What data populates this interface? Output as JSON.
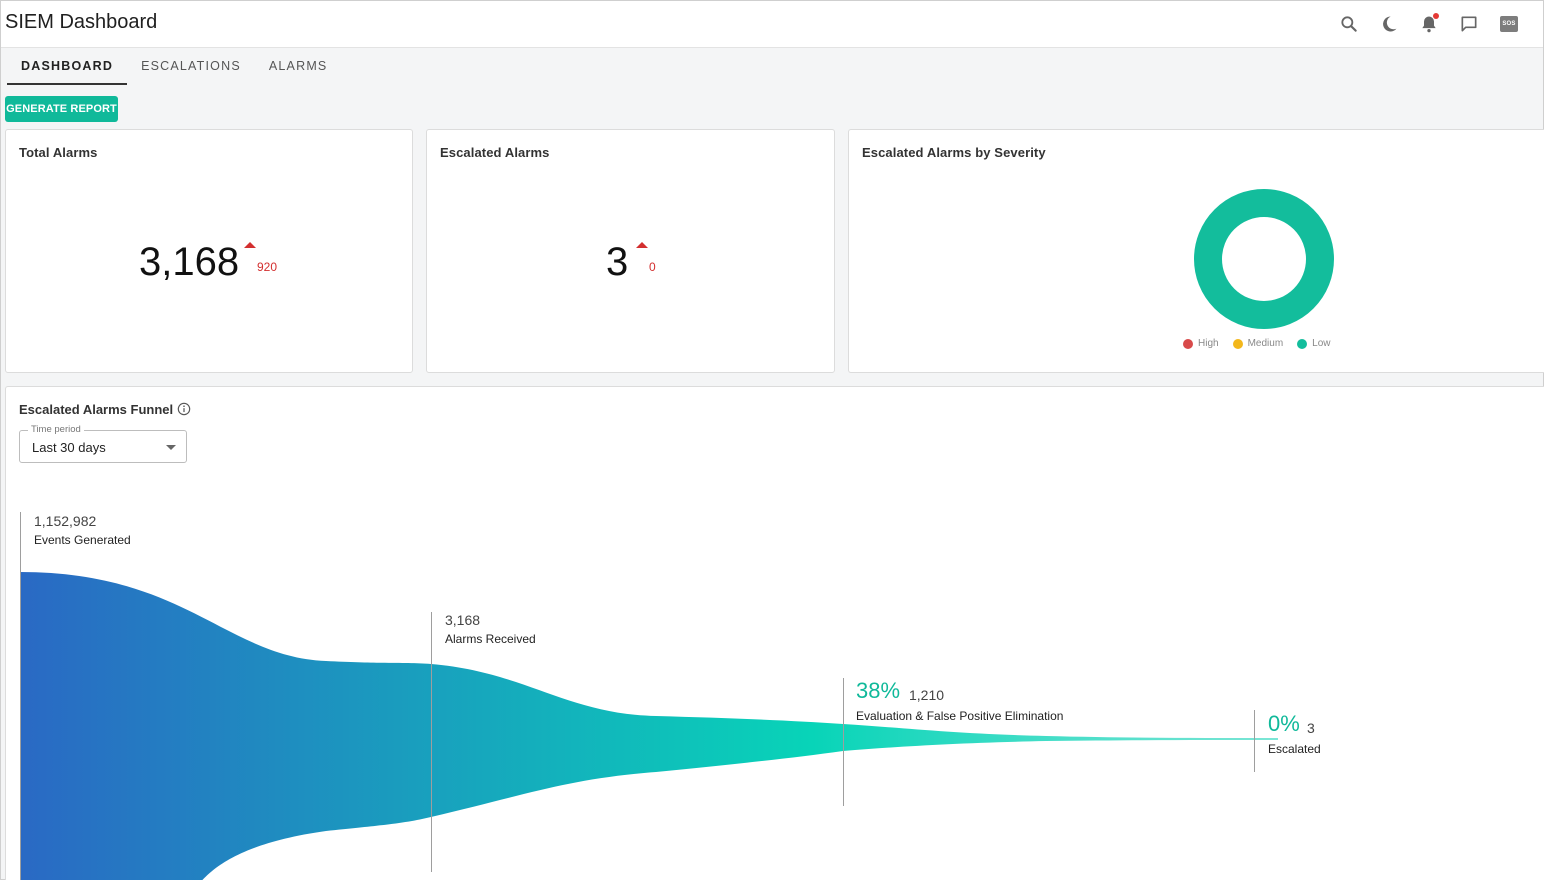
{
  "app": {
    "title": "SIEM Dashboard"
  },
  "top_icons": [
    "search-icon",
    "moon-icon",
    "bell-icon",
    "chat-icon",
    "sos-icon"
  ],
  "sos_label": "SOS",
  "tabs": [
    {
      "label": "DASHBOARD",
      "active": true
    },
    {
      "label": "ESCALATIONS",
      "active": false
    },
    {
      "label": "ALARMS",
      "active": false
    }
  ],
  "generate_button": "GENERATE REPORT",
  "total_alarms": {
    "title": "Total Alarms",
    "value": "3,168",
    "delta": "920"
  },
  "escalated_alarms": {
    "title": "Escalated Alarms",
    "value": "3",
    "delta": "0"
  },
  "severity": {
    "title": "Escalated Alarms by Severity",
    "legend": [
      {
        "label": "High",
        "color": "#d84a4a"
      },
      {
        "label": "Medium",
        "color": "#f3b71b"
      },
      {
        "label": "Low",
        "color": "#13bd9c"
      }
    ]
  },
  "funnel": {
    "title": "Escalated Alarms Funnel",
    "time_period": {
      "label": "Time period",
      "value": "Last 30 days"
    },
    "stages": [
      {
        "count": "1,152,982",
        "label": "Events Generated",
        "percent": ""
      },
      {
        "count": "3,168",
        "label": "Alarms Received",
        "percent": ""
      },
      {
        "count": "1,210",
        "label": "Evaluation & False Positive Elimination",
        "percent": "38%"
      },
      {
        "count": "3",
        "label": "Escalated",
        "percent": "0%"
      }
    ]
  },
  "colors": {
    "accent": "#10b99a",
    "delta_up": "#d32f2f",
    "funnel_start": "#2a69c4",
    "funnel_mid": "#08d4b8",
    "funnel_end": "#7de6d6"
  }
}
